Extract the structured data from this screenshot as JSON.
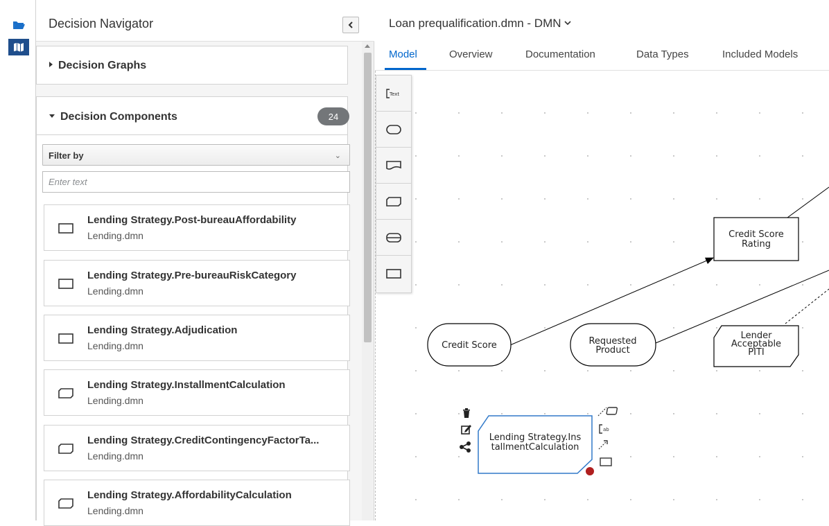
{
  "rail": {
    "folder_icon": "folder-icon",
    "map_icon": "map-icon"
  },
  "navigator": {
    "title": "Decision Navigator",
    "collapse_icon": "chevron-left-icon",
    "graphs": {
      "title": "Decision Graphs"
    },
    "components": {
      "title": "Decision Components",
      "count": "24",
      "filter": {
        "label": "Filter by",
        "placeholder": "Enter text",
        "value": ""
      },
      "items": [
        {
          "name": "Lending Strategy.Post-bureauAffordability",
          "file": "Lending.dmn",
          "icon": "decision-icon"
        },
        {
          "name": "Lending Strategy.Pre-bureauRiskCategory",
          "file": "Lending.dmn",
          "icon": "decision-icon"
        },
        {
          "name": "Lending Strategy.Adjudication",
          "file": "Lending.dmn",
          "icon": "decision-icon"
        },
        {
          "name": "Lending Strategy.InstallmentCalculation",
          "file": "Lending.dmn",
          "icon": "bkm-icon"
        },
        {
          "name": "Lending Strategy.CreditContingencyFactorTa...",
          "file": "Lending.dmn",
          "icon": "bkm-icon"
        },
        {
          "name": "Lending Strategy.AffordabilityCalculation",
          "file": "Lending.dmn",
          "icon": "bkm-icon"
        }
      ]
    }
  },
  "editor": {
    "title": "Loan prequalification.dmn - DMN",
    "tabs": [
      {
        "label": "Model",
        "active": true
      },
      {
        "label": "Overview",
        "active": false
      },
      {
        "label": "Documentation",
        "active": false
      },
      {
        "label": "Data Types",
        "active": false
      },
      {
        "label": "Included Models",
        "active": false
      }
    ],
    "accent_color": "#0066cc",
    "palette": [
      "text-annotation-icon",
      "input-data-icon",
      "knowledge-source-icon",
      "bkm-icon",
      "decision-service-icon",
      "decision-icon"
    ],
    "nodes": {
      "credit_score_rating": [
        "Credit Score",
        "Rating"
      ],
      "credit_score": "Credit Score",
      "requested_product": [
        "Requested",
        "Product"
      ],
      "lender_piti": [
        "Lender",
        "Acceptable",
        "PITI"
      ],
      "selected_bkm": [
        "Lending Strategy.Ins",
        "tallmentCalculation"
      ]
    },
    "toolbox": {
      "left": [
        "trash-icon",
        "edit-icon",
        "share-icon"
      ],
      "right": [
        "association-icon",
        "text-annotation-icon",
        "connector-icon",
        "decision-icon"
      ]
    }
  }
}
